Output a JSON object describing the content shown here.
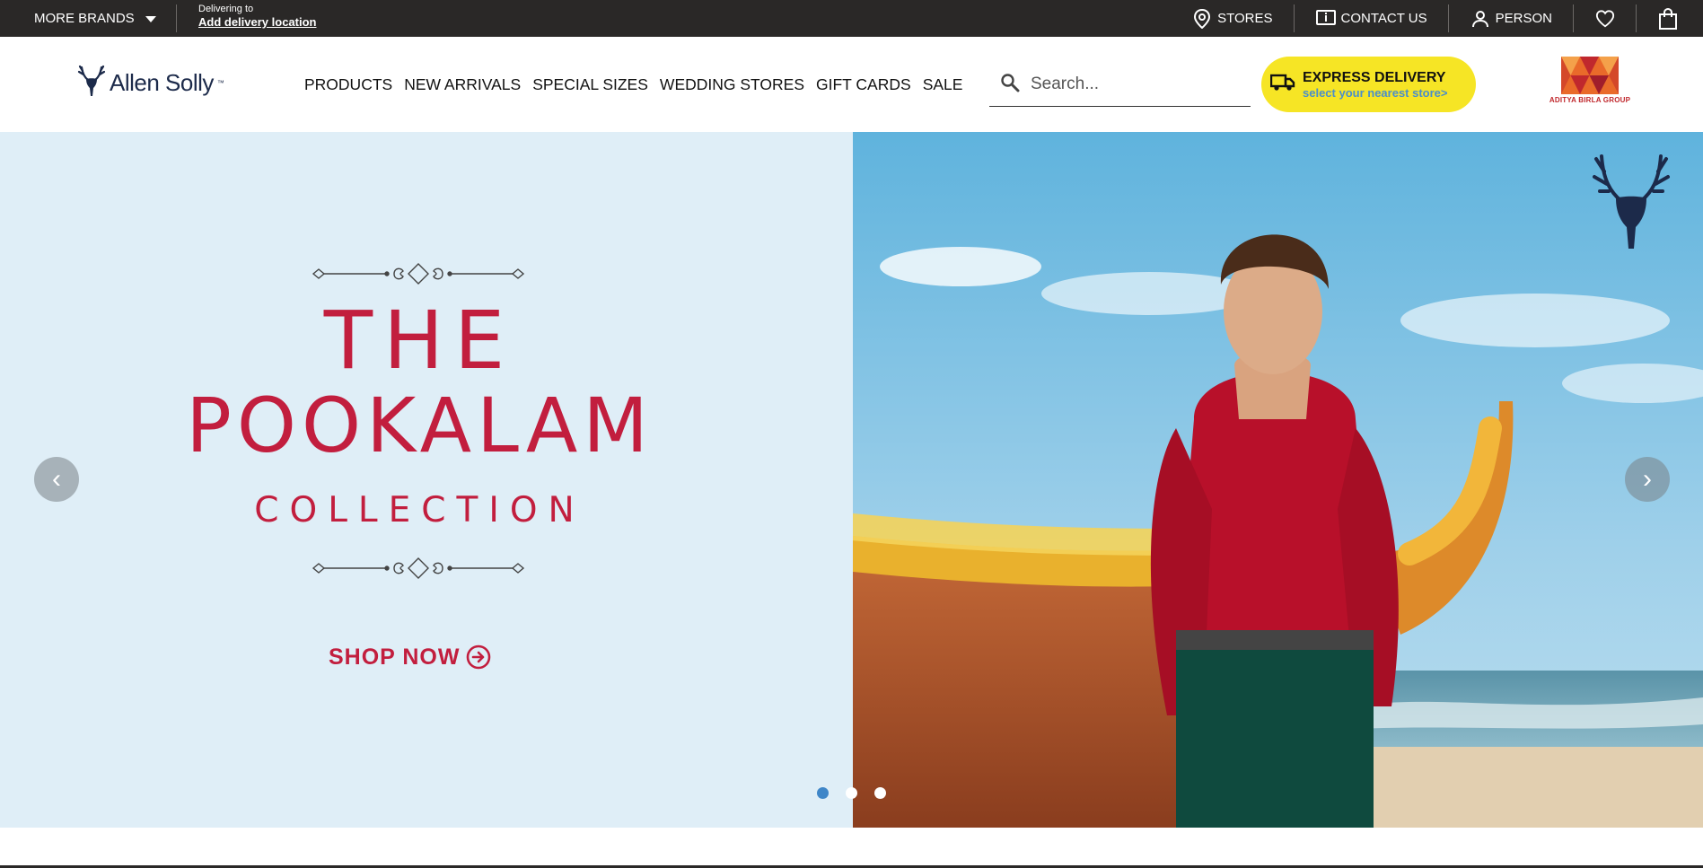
{
  "topbar": {
    "more_brands": "MORE BRANDS",
    "delivering_to": "Delivering to",
    "add_location": "Add delivery location",
    "stores": "STORES",
    "contact_us": "CONTACT US",
    "person": "PERSON"
  },
  "header": {
    "logo_text": "Allen Solly",
    "logo_tm": "™",
    "nav": [
      "PRODUCTS",
      "NEW ARRIVALS",
      "SPECIAL SIZES",
      "WEDDING STORES",
      "GIFT CARDS",
      "SALE"
    ],
    "search_placeholder": "Search...",
    "express_title": "EXPRESS DELIVERY",
    "express_sub": "select your nearest store>",
    "group_logo_text": "ADITYA BIRLA GROUP"
  },
  "hero": {
    "line1": "THE",
    "line2": "POOKALAM",
    "line3": "COLLECTION",
    "cta": "SHOP NOW",
    "prev_icon": "‹",
    "next_icon": "›",
    "slides": 3,
    "active_slide": 1
  },
  "colors": {
    "topbar_bg": "#2a2827",
    "brand_navy": "#1c2a4a",
    "hero_red": "#c21e3e",
    "express_yellow": "#f6e525",
    "dot_active": "#3f86c8"
  }
}
